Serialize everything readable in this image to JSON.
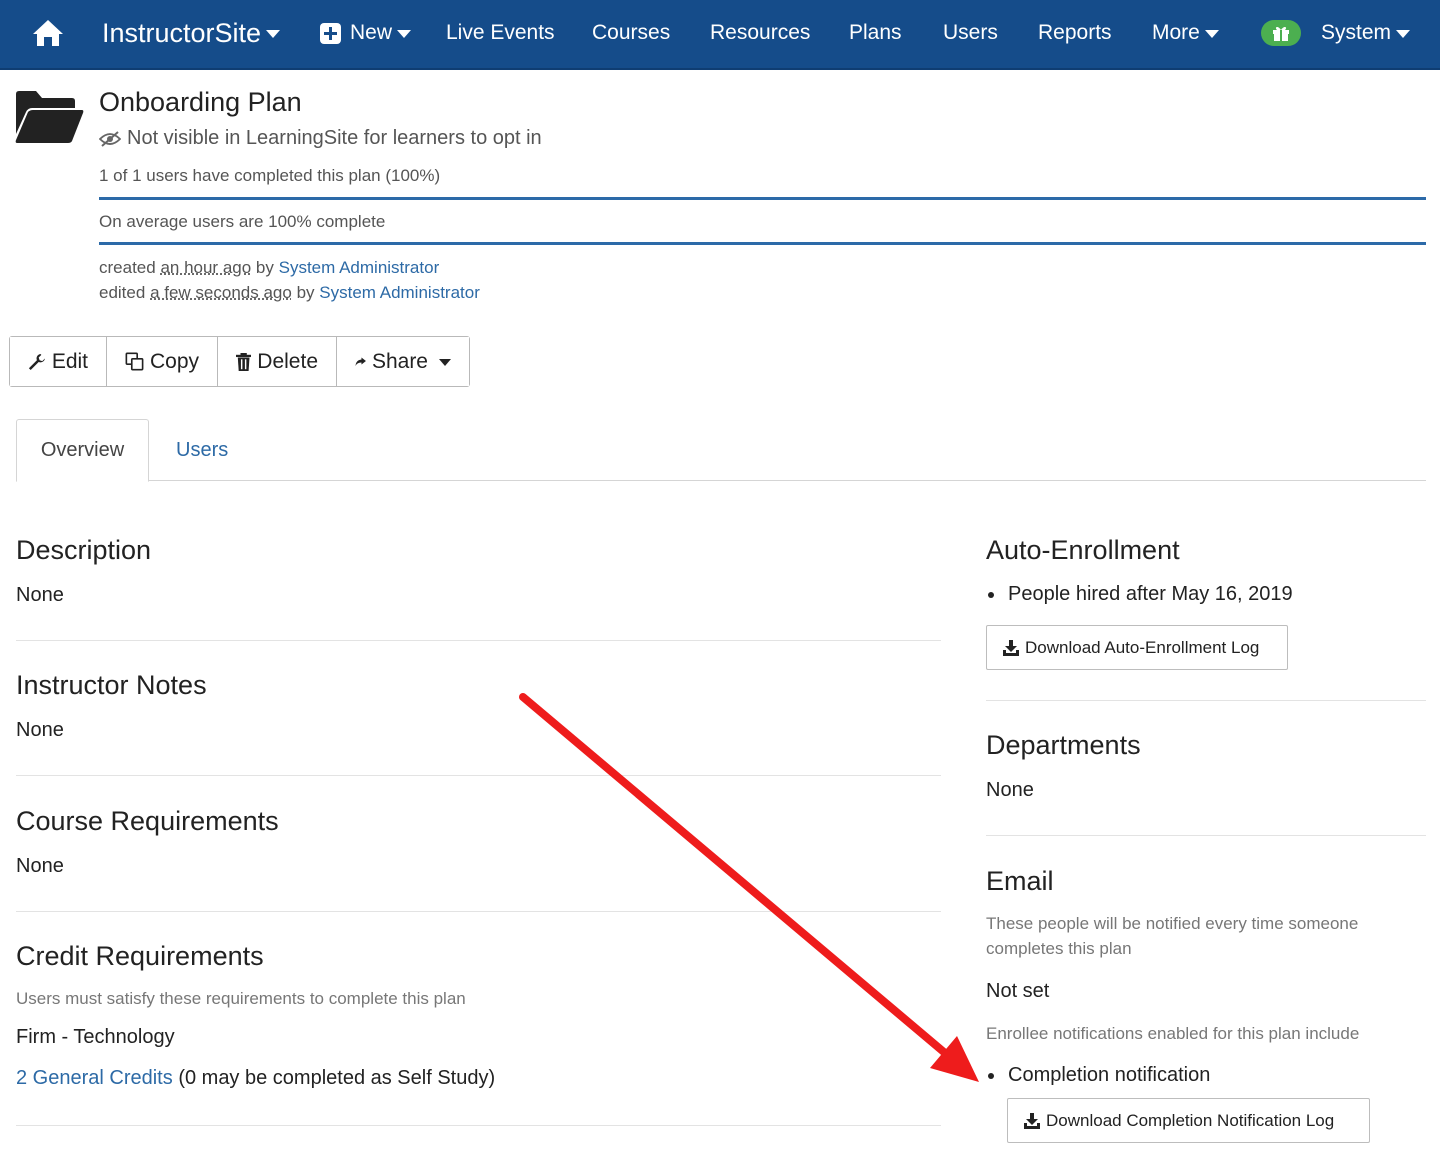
{
  "nav": {
    "brand": "InstructorSite",
    "new": "New",
    "live_events": "Live Events",
    "courses": "Courses",
    "resources": "Resources",
    "plans": "Plans",
    "users": "Users",
    "reports": "Reports",
    "more": "More",
    "system": "System"
  },
  "plan": {
    "title": "Onboarding Plan",
    "visibility": "Not visible in LearningSite for learners to opt in",
    "completed_stat": "1 of 1 users have completed this plan (100%)",
    "completed_percent": 100,
    "average_stat": "On average users are 100% complete",
    "average_percent": 100,
    "created_label": "created",
    "created_when": "an hour ago",
    "created_by_label": "by",
    "created_by": "System Administrator",
    "edited_label": "edited",
    "edited_when": "a few seconds ago",
    "edited_by_label": "by",
    "edited_by": "System Administrator"
  },
  "actions": {
    "edit": "Edit",
    "copy": "Copy",
    "delete": "Delete",
    "share": "Share"
  },
  "tabs": {
    "overview": "Overview",
    "users": "Users"
  },
  "left": {
    "description_title": "Description",
    "description_value": "None",
    "notes_title": "Instructor Notes",
    "notes_value": "None",
    "course_req_title": "Course Requirements",
    "course_req_value": "None",
    "credit_req_title": "Credit Requirements",
    "credit_req_help": "Users must satisfy these requirements to complete this plan",
    "credit_group": "Firm - Technology",
    "credit_link": "2 General Credits",
    "credit_note": "(0 may be completed as Self Study)"
  },
  "right": {
    "auto_title": "Auto-Enrollment",
    "auto_rule": "People hired after May 16, 2019",
    "auto_download": "Download Auto-Enrollment Log",
    "dept_title": "Departments",
    "dept_value": "None",
    "email_title": "Email",
    "email_help": "These people will be notified every time someone completes this plan",
    "email_value": "Not set",
    "enrollee_help": "Enrollee notifications enabled for this plan include",
    "completion_item": "Completion notification",
    "completion_download": "Download Completion Notification Log"
  },
  "colors": {
    "navbar": "#154c8a",
    "link": "#2d6aa6",
    "gift": "#4caf50",
    "annotation_arrow": "#ee1c1c"
  }
}
